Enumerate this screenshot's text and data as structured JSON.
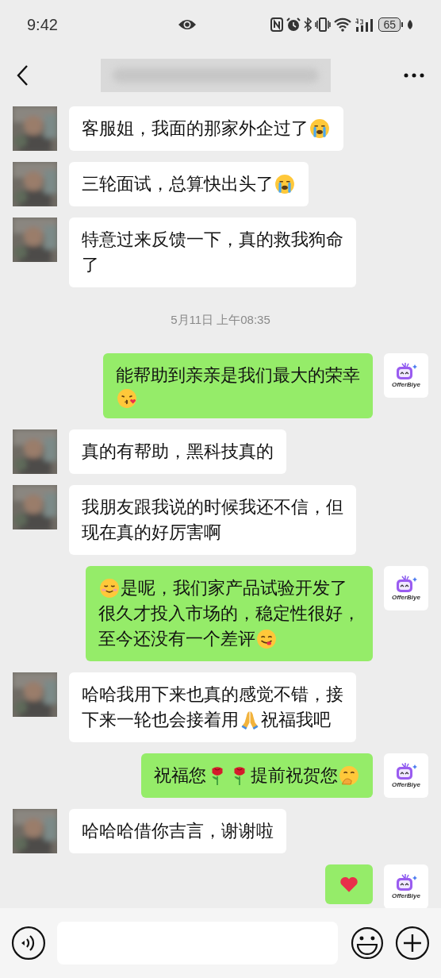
{
  "status_bar": {
    "time": "9:42",
    "battery": "65"
  },
  "messages": [
    {
      "kind": "message",
      "outgoing": false,
      "lines": [
        [
          {
            "kind": "text",
            "text": "客服姐，我面的那家外企过了"
          },
          {
            "kind": "sob"
          }
        ]
      ]
    },
    {
      "kind": "message",
      "outgoing": false,
      "lines": [
        [
          {
            "kind": "text",
            "text": "三轮面试，总算快出头了"
          },
          {
            "kind": "sob"
          }
        ]
      ]
    },
    {
      "kind": "message",
      "outgoing": false,
      "lines": [
        [
          {
            "kind": "text",
            "text": "特意过来反馈一下，真的救我狗命"
          }
        ],
        [
          {
            "kind": "text",
            "text": "了"
          }
        ]
      ]
    },
    {
      "kind": "timestamp",
      "text": "5月11日 上午08:35"
    },
    {
      "kind": "message",
      "outgoing": true,
      "avatar_label": "OfferBiye",
      "lines": [
        [
          {
            "kind": "text",
            "text": "能帮助到亲亲是我们最大的荣幸"
          }
        ],
        [
          {
            "kind": "kiss"
          }
        ]
      ]
    },
    {
      "kind": "message",
      "outgoing": false,
      "lines": [
        [
          {
            "kind": "text",
            "text": "真的有帮助，黑科技真的"
          }
        ]
      ]
    },
    {
      "kind": "message",
      "outgoing": false,
      "lines": [
        [
          {
            "kind": "text",
            "text": "我朋友跟我说的时候我还不信，但"
          }
        ],
        [
          {
            "kind": "text",
            "text": "现在真的好厉害啊"
          }
        ]
      ]
    },
    {
      "kind": "message",
      "outgoing": true,
      "avatar_label": "OfferBiye",
      "lines": [
        [
          {
            "kind": "smile"
          },
          {
            "kind": "text",
            "text": "是呢，我们家产品试验开发了"
          }
        ],
        [
          {
            "kind": "text",
            "text": "很久才投入市场的，稳定性很好，"
          }
        ],
        [
          {
            "kind": "text",
            "text": "至今还没有一个差评"
          },
          {
            "kind": "yum"
          }
        ]
      ]
    },
    {
      "kind": "message",
      "outgoing": false,
      "lines": [
        [
          {
            "kind": "text",
            "text": "哈哈我用下来也真的感觉不错，接"
          }
        ],
        [
          {
            "kind": "text",
            "text": "下来一轮也会接着用"
          },
          {
            "kind": "pray"
          },
          {
            "kind": "text",
            "text": "祝福我吧"
          }
        ]
      ]
    },
    {
      "kind": "message",
      "outgoing": true,
      "avatar_label": "OfferBiye",
      "lines": [
        [
          {
            "kind": "text",
            "text": "祝福您"
          },
          {
            "kind": "rose"
          },
          {
            "kind": "rose"
          },
          {
            "kind": "text",
            "text": "提前祝贺您"
          },
          {
            "kind": "giggle"
          }
        ]
      ]
    },
    {
      "kind": "message",
      "outgoing": false,
      "lines": [
        [
          {
            "kind": "text",
            "text": "哈哈哈借你吉言，谢谢啦"
          }
        ]
      ]
    },
    {
      "kind": "message",
      "outgoing": true,
      "avatar_label": "OfferBiye",
      "lines": [
        [
          {
            "kind": "heart"
          }
        ]
      ]
    }
  ]
}
